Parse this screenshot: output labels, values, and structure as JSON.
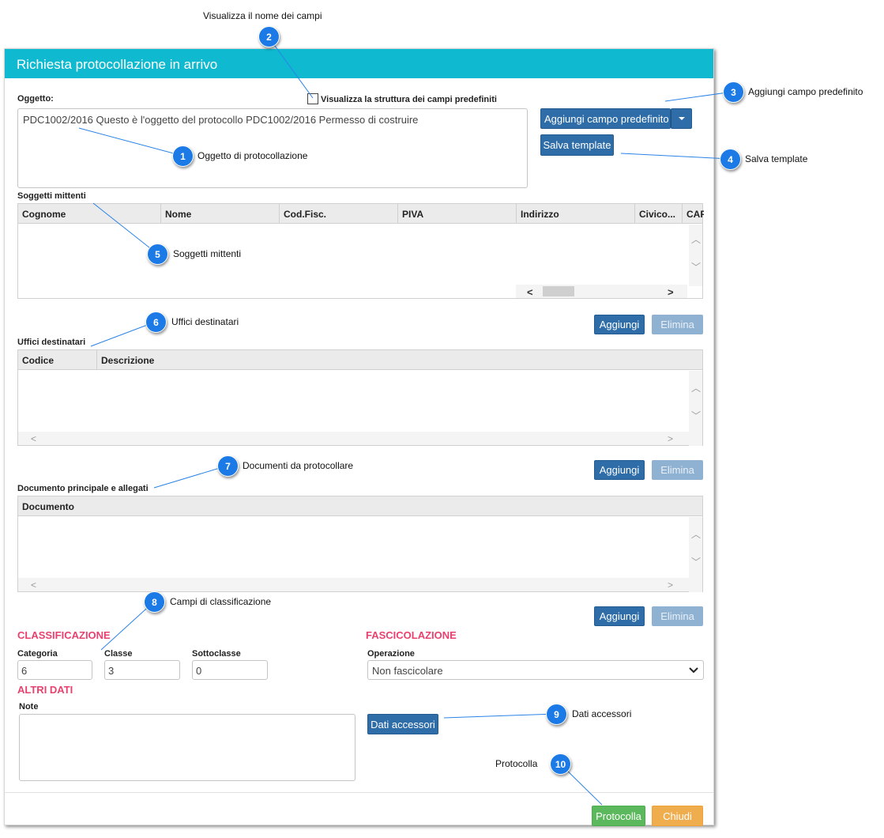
{
  "dialog": {
    "title": "Richiesta protocollazione in arrivo"
  },
  "oggetto": {
    "label": "Oggetto:",
    "value": "PDC1002/2016   Questo è l'oggetto del protocollo PDC1002/2016  Permesso di costruire",
    "checkbox_label": "Visualizza la struttura dei campi predefiniti",
    "checkbox_checked": false
  },
  "side_buttons": {
    "add_field": "Aggiungi campo predefinito",
    "save_template": "Salva template"
  },
  "mittenti": {
    "label": "Soggetti mittenti",
    "columns": [
      "Cognome",
      "Nome",
      "Cod.Fisc.",
      "PIVA",
      "Indirizzo",
      "Civico...",
      "CAF"
    ]
  },
  "uffici": {
    "label": "Uffici destinatari",
    "columns": [
      "Codice",
      "Descrizione"
    ],
    "add_label": "Aggiungi",
    "delete_label": "Elimina"
  },
  "documenti": {
    "label": "Documento principale e allegati",
    "columns": [
      "Documento"
    ],
    "add_label": "Aggiungi",
    "delete_label": "Elimina"
  },
  "classificazione": {
    "add_label": "Aggiungi",
    "delete_label": "Elimina",
    "title": "CLASSIFICAZIONE",
    "categoria_label": "Categoria",
    "categoria_value": "6",
    "classe_label": "Classe",
    "classe_value": "3",
    "sottoclasse_label": "Sottoclasse",
    "sottoclasse_value": "0"
  },
  "fascicolazione": {
    "title": "FASCICOLAZIONE",
    "operazione_label": "Operazione",
    "operazione_value": "Non fascicolare"
  },
  "altri_dati": {
    "title": "ALTRI DATI",
    "note_label": "Note",
    "dati_accessori_label": "Dati accessori"
  },
  "footer": {
    "protocolla_label": "Protocolla",
    "chiudi_label": "Chiudi"
  },
  "callouts": [
    {
      "number": "1",
      "text": "Oggetto di protocollazione"
    },
    {
      "number": "2",
      "text": "Visualizza il nome dei campi"
    },
    {
      "number": "3",
      "text": "Aggiungi campo predefinito"
    },
    {
      "number": "4",
      "text": "Salva template"
    },
    {
      "number": "5",
      "text": "Soggetti mittenti"
    },
    {
      "number": "6",
      "text": "Uffici destinatari"
    },
    {
      "number": "7",
      "text": "Documenti da protocollare"
    },
    {
      "number": "8",
      "text": "Campi di classificazione"
    },
    {
      "number": "9",
      "text": "Dati accessori"
    },
    {
      "number": "10",
      "text": "Protocolla"
    }
  ],
  "colors": {
    "header": "#0fb9cf",
    "button_primary": "#2f6da8",
    "button_success": "#5cb85c",
    "button_warning": "#f0ad4e",
    "section_title": "#e8416e",
    "callout": "#1c7ae6"
  }
}
